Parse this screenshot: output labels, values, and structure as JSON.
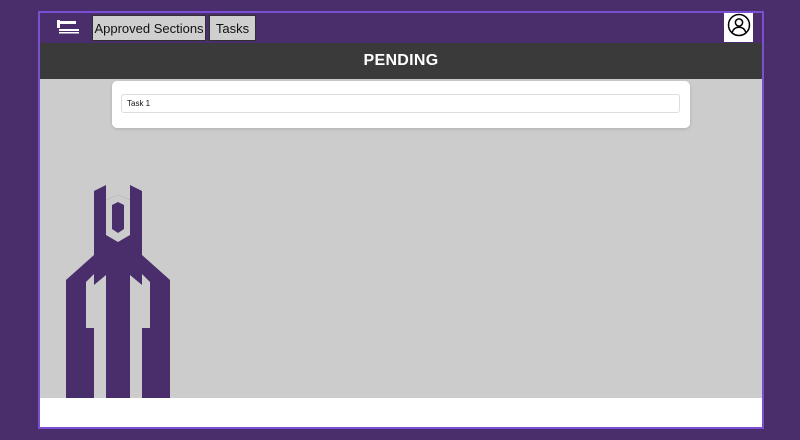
{
  "nav": {
    "logo_icon": "hammer-logo-icon",
    "items": [
      {
        "label": "Approved Sections"
      },
      {
        "label": "Tasks"
      }
    ],
    "profile_icon": "user-circle-icon"
  },
  "page": {
    "title": "PENDING"
  },
  "tasks": [
    {
      "label": "Task 1"
    }
  ],
  "decor": {
    "tower_icon": "tower-graphic"
  },
  "colors": {
    "frame_bg": "#4a2d6b",
    "frame_border": "#7b4fd1",
    "title_bar": "#3a3a3a",
    "content_bg": "#cccccc",
    "nav_button": "#cfcfcf"
  }
}
